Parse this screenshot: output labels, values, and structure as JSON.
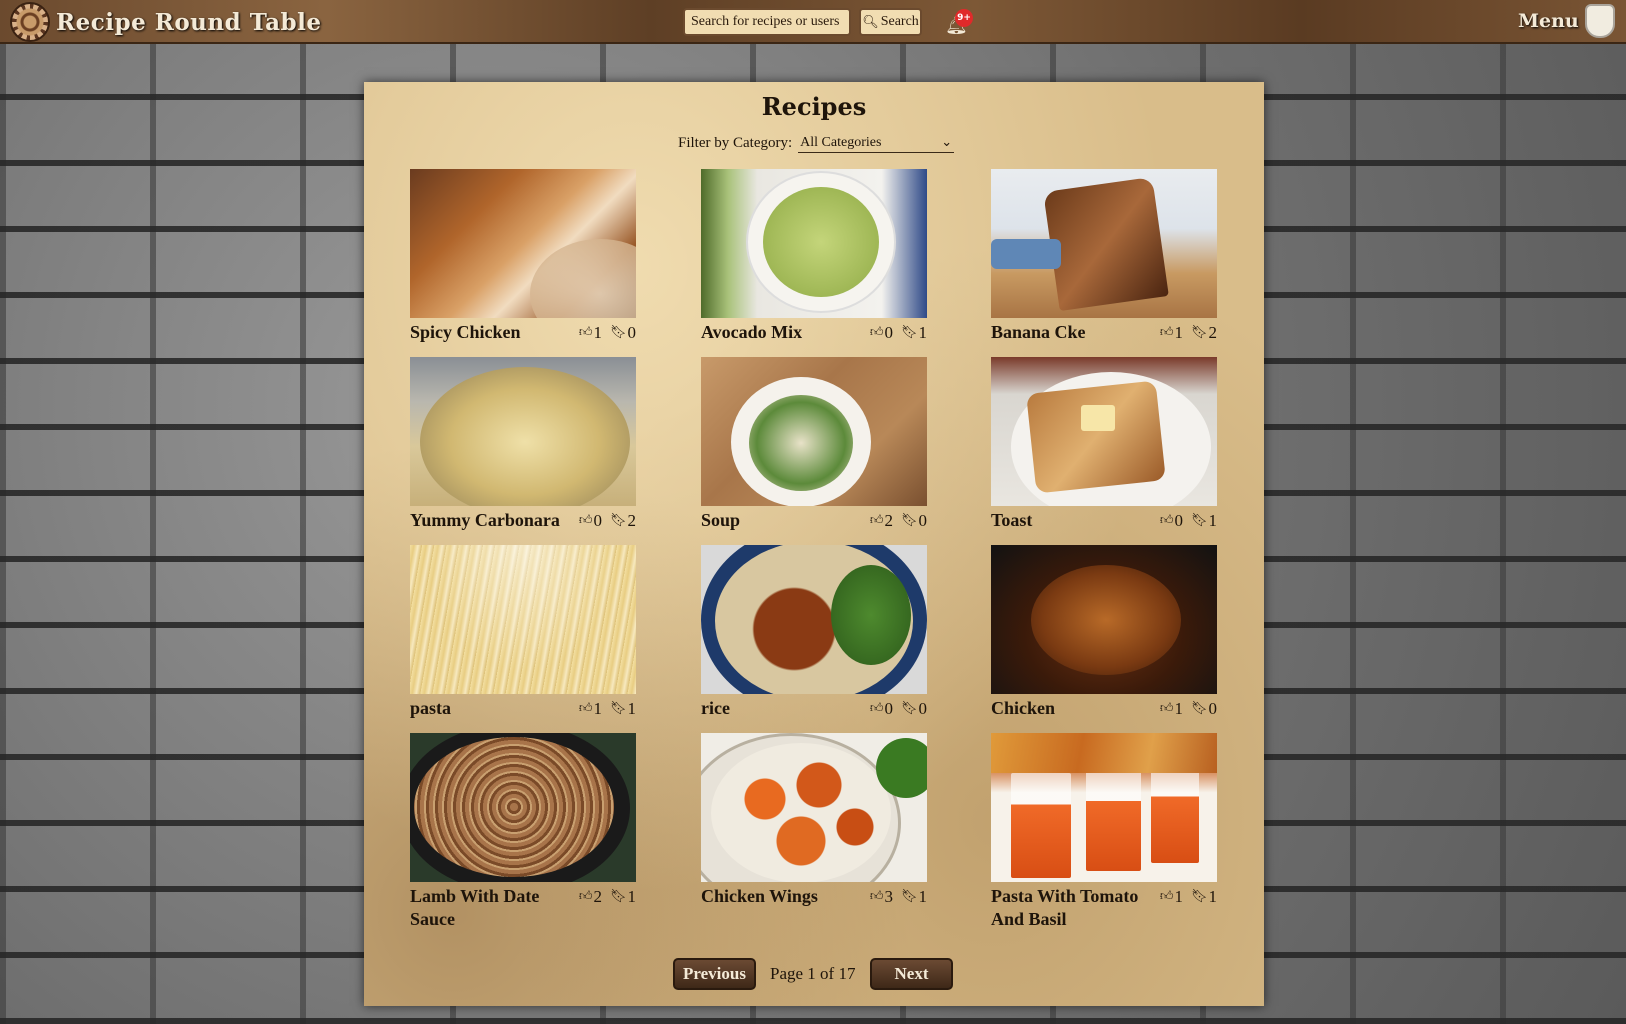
{
  "app": {
    "title": "Recipe Round Table"
  },
  "header": {
    "search_placeholder": "Search for recipes or users",
    "search_button": "Search",
    "notification_badge": "9+",
    "menu_label": "Menu"
  },
  "page": {
    "title": "Recipes",
    "filter_label": "Filter by Category:",
    "filter_value": "All Categories"
  },
  "recipes": [
    {
      "title": "Spicy Chicken",
      "likes": "1",
      "saves": "0"
    },
    {
      "title": "Avocado Mix",
      "likes": "0",
      "saves": "1"
    },
    {
      "title": "Banana Cke",
      "likes": "1",
      "saves": "2"
    },
    {
      "title": "Yummy Carbonara",
      "likes": "0",
      "saves": "2"
    },
    {
      "title": "Soup",
      "likes": "2",
      "saves": "0"
    },
    {
      "title": "Toast",
      "likes": "0",
      "saves": "1"
    },
    {
      "title": "pasta",
      "likes": "1",
      "saves": "1"
    },
    {
      "title": "rice",
      "likes": "0",
      "saves": "0"
    },
    {
      "title": "Chicken",
      "likes": "1",
      "saves": "0"
    },
    {
      "title": "Lamb With Date Sauce",
      "likes": "2",
      "saves": "1"
    },
    {
      "title": "Chicken Wings",
      "likes": "3",
      "saves": "1"
    },
    {
      "title": "Pasta With Tomato And Basil",
      "likes": "1",
      "saves": "1"
    }
  ],
  "pagination": {
    "previous": "Previous",
    "label": "Page 1 of 17",
    "next": "Next"
  }
}
